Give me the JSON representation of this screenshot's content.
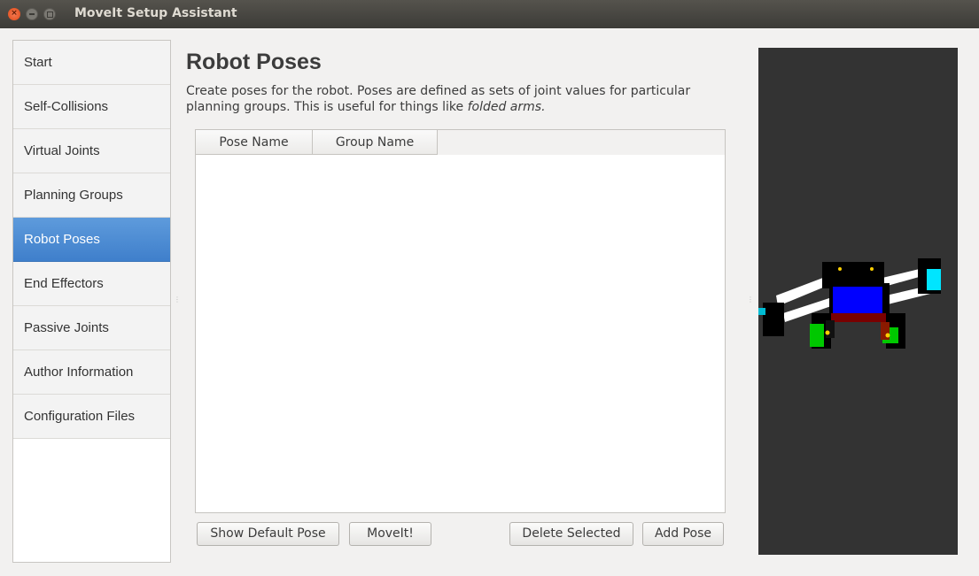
{
  "window": {
    "title": "MoveIt Setup Assistant"
  },
  "nav": {
    "items": [
      {
        "label": "Start"
      },
      {
        "label": "Self-Collisions"
      },
      {
        "label": "Virtual Joints"
      },
      {
        "label": "Planning Groups"
      },
      {
        "label": "Robot Poses",
        "active": true
      },
      {
        "label": "End Effectors"
      },
      {
        "label": "Passive Joints"
      },
      {
        "label": "Author Information"
      },
      {
        "label": "Configuration Files"
      }
    ]
  },
  "main": {
    "heading": "Robot Poses",
    "description_line1": "Create poses for the robot. Poses are defined as sets of joint values for particular",
    "description_line2_prefix": "planning groups. This is useful for things like ",
    "description_line2_emph": "folded arms.",
    "table": {
      "columns": [
        "Pose Name",
        "Group Name"
      ],
      "rows": []
    },
    "buttons": {
      "show_default": "Show Default Pose",
      "moveit": "MoveIt!",
      "delete_selected": "Delete Selected",
      "add_pose": "Add Pose"
    }
  },
  "colors": {
    "accent": "#3f7fcb",
    "viewer_bg": "#333333"
  }
}
